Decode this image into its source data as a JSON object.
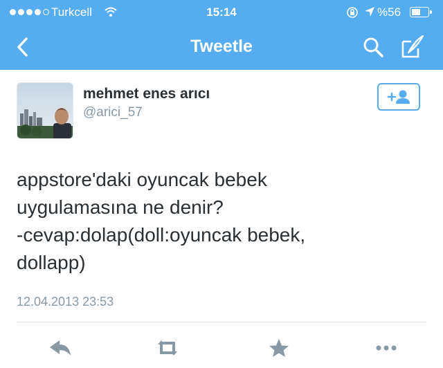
{
  "status_bar": {
    "carrier": "Turkcell",
    "time": "15:14",
    "battery": "%56",
    "battery_level": 0.56
  },
  "nav": {
    "title": "Tweetle",
    "icons": [
      "chevron-left-icon",
      "search-icon",
      "compose-icon"
    ]
  },
  "tweet": {
    "display_name": "mehmet enes arıcı",
    "username": "@arici_57",
    "text_lines": [
      "appstore'daki oyuncak bebek",
      "uygulamasına ne denir?",
      "-cevap:dolap(doll:oyuncak bebek,",
      "dollapp)"
    ],
    "timestamp": "12.04.2013 23:53"
  },
  "actions": [
    "reply-icon",
    "retweet-icon",
    "star-icon",
    "more-icon"
  ],
  "colors": {
    "header": "#55acee",
    "action_icon": "#8899a6",
    "follow_button": "#55acee"
  }
}
